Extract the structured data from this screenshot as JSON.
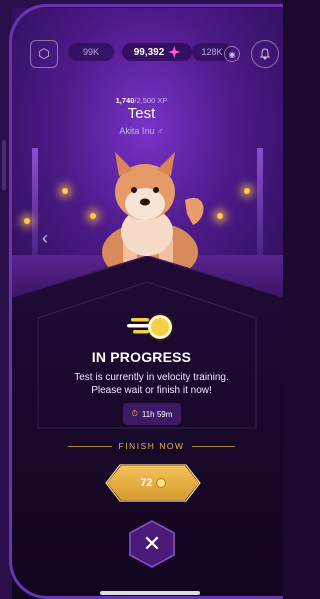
{
  "topbar": {
    "currency_left": "99K",
    "gems": "99,392",
    "currency_right": "128K",
    "profile_icon": "hexagon-profile-icon",
    "globe_icon": "globe-icon",
    "bell_icon": "bell-icon"
  },
  "pet": {
    "xp_current": "1,740",
    "xp_rest": "/2,500 XP",
    "name": "Test",
    "breed": "Akita Inu ♂"
  },
  "modal": {
    "title": "IN PROGRESS",
    "message": "Test is currently in velocity training. Please wait or finish it now!",
    "timer": "11h 59m",
    "finish_label": "FINISH NOW",
    "finish_cost": "72",
    "close_symbol": "✕"
  },
  "colors": {
    "accent_gold": "#e0b659",
    "background": "#12061f",
    "scene_purple": "#7a32c8"
  }
}
